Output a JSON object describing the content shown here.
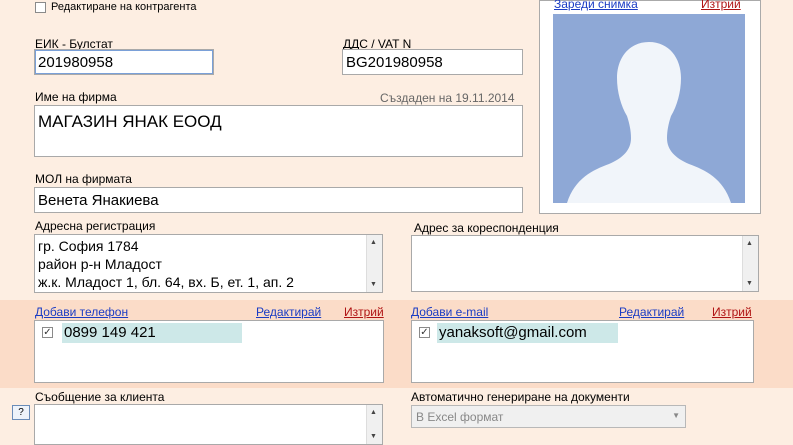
{
  "edit_contractor": {
    "label": "Редактиране на контрагента",
    "checked": false
  },
  "eik": {
    "label": "ЕИК - Булстат",
    "value": "201980958"
  },
  "vat": {
    "label": "ДДС / VAT N",
    "value": "BG201980958"
  },
  "company": {
    "label": "Име на фирма",
    "created": "Създаден на 19.11.2014",
    "value": "МАГАЗИН ЯНАК ЕООД"
  },
  "mol": {
    "label": "МОЛ на фирмата",
    "value": "Венета Янакиева"
  },
  "address_reg": {
    "label": "Адресна регистрация",
    "lines": [
      "гр. София 1784",
      "район р-н Младост",
      "ж.к. Младост 1, бл. 64, вх. Б, ет. 1, ап. 2"
    ]
  },
  "address_corr": {
    "label": "Адрес за кореспонденция",
    "value": ""
  },
  "photo": {
    "load": "Зареди снимка",
    "delete": "Изтрий"
  },
  "phones": {
    "add": "Добави телефон",
    "edit": "Редактирай",
    "delete": "Изтрий",
    "items": [
      {
        "value": "0899 149 421",
        "checked": true
      }
    ]
  },
  "emails": {
    "add": "Добави e-mail",
    "edit": "Редактирай",
    "delete": "Изтрий",
    "items": [
      {
        "value": "yanaksoft@gmail.com",
        "checked": true
      }
    ]
  },
  "client_message": {
    "label": "Съобщение за клиента",
    "help": "?"
  },
  "auto_docs": {
    "label": "Автоматично генериране на документи",
    "selected": "В Excel формат"
  }
}
